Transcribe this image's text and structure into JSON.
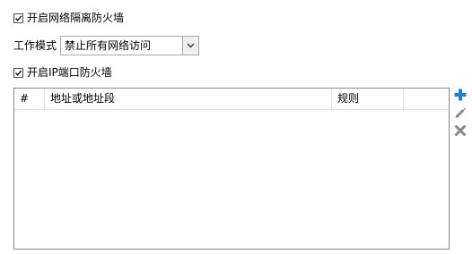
{
  "isolation_firewall": {
    "label": "开启网络隔离防火墙",
    "checked": true
  },
  "work_mode": {
    "label": "工作模式",
    "selected": "禁止所有网络访问"
  },
  "ip_port_firewall": {
    "label": "开启IP端口防火墙",
    "checked": true
  },
  "rules_table": {
    "columns": [
      "#",
      "地址或地址段",
      "规则"
    ],
    "rows": []
  },
  "actions": {
    "add_icon": "plus-icon",
    "edit_icon": "pencil-icon",
    "delete_icon": "x-icon",
    "add_color": "#1e7fd8",
    "disabled_color": "#808080"
  }
}
